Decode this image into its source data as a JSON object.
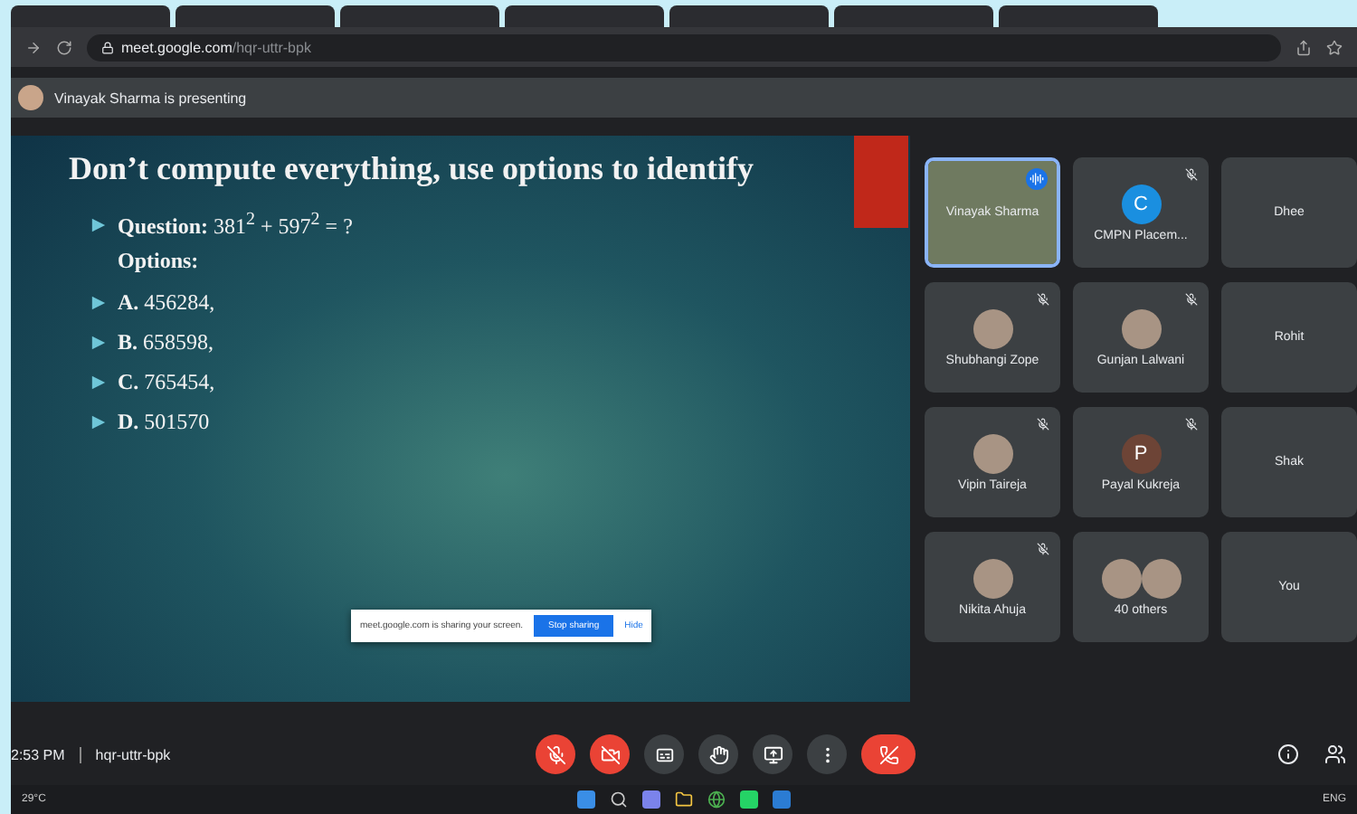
{
  "browser": {
    "url_host": "meet.google.com",
    "url_path": "/hqr-uttr-bpk"
  },
  "presenting": {
    "text": "Vinayak Sharma is presenting"
  },
  "slide": {
    "title": "Don’t compute everything, use options to identify",
    "items": [
      {
        "text": "**Question:** 381$^{2}$ + 597$^{2}$ = ?",
        "bullet": true
      },
      {
        "text": "**Options:**",
        "bullet": false
      },
      {
        "text": "**A.** 456284,",
        "bullet": true
      },
      {
        "text": "**B.** 658598,",
        "bullet": true
      },
      {
        "text": "**C.** 765454,",
        "bullet": true
      },
      {
        "text": "**D.** 501570",
        "bullet": true
      }
    ]
  },
  "share_bar": {
    "message": "meet.google.com is sharing your screen.",
    "stop_button": "Stop sharing",
    "hide_link": "Hide"
  },
  "participants": [
    {
      "name": "Vinayak Sharma",
      "kind": "video",
      "muted": false,
      "speaking": true
    },
    {
      "name": "CMPN Placem...",
      "kind": "letter",
      "letter": "C",
      "color": "#1a8fe0",
      "muted": true,
      "speaking": false
    },
    {
      "name": "Dhee",
      "kind": "none",
      "muted": false,
      "speaking": false
    },
    {
      "name": "Shubhangi Zope",
      "kind": "photo",
      "muted": true,
      "speaking": false
    },
    {
      "name": "Gunjan Lalwani",
      "kind": "photo",
      "muted": true,
      "speaking": false
    },
    {
      "name": "Rohit",
      "kind": "none",
      "muted": false,
      "speaking": false
    },
    {
      "name": "Vipin Taireja",
      "kind": "photo",
      "muted": true,
      "speaking": false
    },
    {
      "name": "Payal Kukreja",
      "kind": "letter",
      "letter": "P",
      "color": "#6d4436",
      "muted": true,
      "speaking": false
    },
    {
      "name": "Shak",
      "kind": "none",
      "muted": false,
      "speaking": false
    },
    {
      "name": "Nikita Ahuja",
      "kind": "photo",
      "muted": true,
      "speaking": false
    },
    {
      "name": "40 others",
      "kind": "group",
      "muted": false,
      "speaking": false
    },
    {
      "name": "You",
      "kind": "none",
      "muted": false,
      "speaking": false
    }
  ],
  "meeting": {
    "time": "2:53 PM",
    "code": "hqr-uttr-bpk"
  },
  "controls": [
    {
      "kind": "mic",
      "off": true
    },
    {
      "kind": "camera",
      "off": true
    },
    {
      "kind": "captions",
      "off": false
    },
    {
      "kind": "hand",
      "off": false
    },
    {
      "kind": "present",
      "off": false
    },
    {
      "kind": "more",
      "off": false
    },
    {
      "kind": "end"
    }
  ],
  "taskbar": {
    "weather": "29°C",
    "language": "ENG"
  }
}
